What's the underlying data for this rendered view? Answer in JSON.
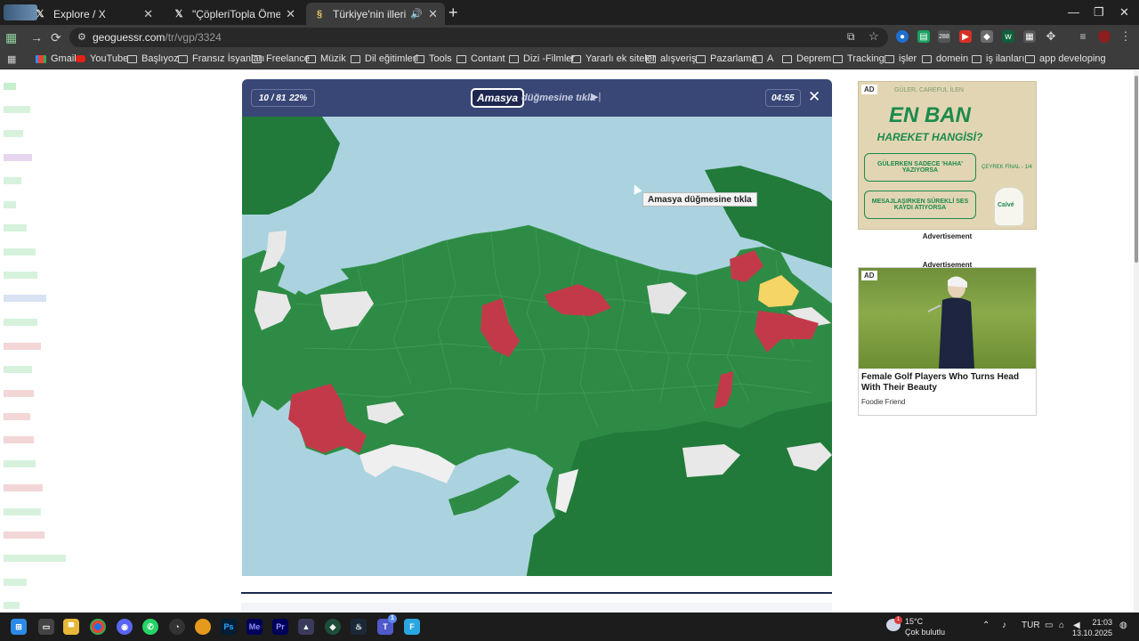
{
  "browser": {
    "tabs": [
      {
        "title": "Explore / X",
        "favicon": "x-icon",
        "active": false
      },
      {
        "title": "\"ÇöpleriTopla Ömer\" - Search /",
        "favicon": "x-icon",
        "active": false
      },
      {
        "title": "Türkiye'nin illeri - Harita Te",
        "favicon": "geoguessr-icon",
        "active": true
      }
    ],
    "new_tab": "+",
    "url": {
      "host": "geoguessr.com",
      "path": "/tr/vgp/3324"
    },
    "bookmarks": [
      "Gmail",
      "YouTube",
      "Başlıyoz",
      "Fransız İsyanları",
      "Freelance",
      "Müzik",
      "Dil eğitimleri",
      "Tools",
      "Contant",
      "Dizi -Filmler",
      "Yararlı ek siteler",
      "alışveriş",
      "Pazarlama",
      "A",
      "Deprem",
      "Tracking",
      "işler",
      "domein",
      "iş ilanları",
      "app developing"
    ],
    "extension_badge": "288"
  },
  "game": {
    "progress": "10 / 81",
    "percent": "22%",
    "target": "Amasya",
    "prompt": "düğmesine tıkla",
    "timer": "04:55",
    "tooltip": "Amasya düğmesine tıkla",
    "colors": {
      "header": "#394776",
      "sea": "#aad3df",
      "correct": "#2e8b45",
      "correct_dark": "#217a3a",
      "wrong": "#c23a4a",
      "partial": "#f5d565",
      "unplayed": "#e8e8e8"
    }
  },
  "ads": {
    "ad_badge": "AD",
    "ad1": {
      "top_line": "GÜLER, CAREFUL İLEN",
      "title_a": "EN",
      "title_b": "BAN",
      "subtitle": "HAREKET HANGİSİ?",
      "option1": "GÜLERKEN SADECE 'HAHA' YAZIYORSA",
      "option2": "MESAJLAŞIRKEN SÜREKLİ SES KAYDI ATIYORSA",
      "small": "ÇEYREK FİNAL - 1/4",
      "brand": "Calvé",
      "caption": "Advertisement"
    },
    "ad2": {
      "caption": "Advertisement",
      "headline": "Female Golf Players Who Turns Head With Their Beauty",
      "source": "Foodie Friend"
    }
  },
  "taskbar": {
    "weather": {
      "temp": "15°C",
      "condition": "Çok bulutlu",
      "badge": "1"
    },
    "language": "TUR",
    "time": "21:03",
    "date": "13.10.2025",
    "teams_badge": "1"
  }
}
